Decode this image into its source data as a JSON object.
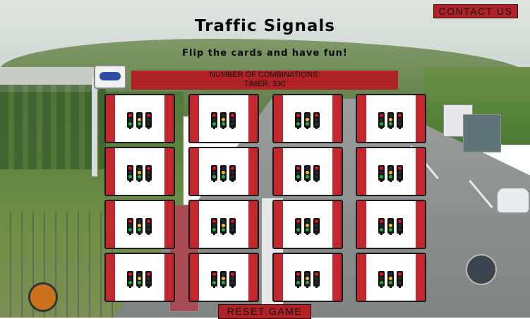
{
  "header": {
    "contact_label": "CONTACT US",
    "title": "Traffic Signals",
    "subtitle": "Flip the cards and have fun!"
  },
  "stats": {
    "combinations_label": "NUMBER OF COMBINATIONS:",
    "timer_label": "TIMER: 330"
  },
  "board": {
    "rows": 4,
    "columns": 4,
    "card_face": "traffic-lights-icon",
    "cards": 16
  },
  "colors": {
    "accent": "#b12226",
    "card_band": "#c1272d",
    "lamp_red": "#e0141b",
    "lamp_yellow": "#f2c21b",
    "lamp_green": "#1fb23a"
  },
  "footer": {
    "reset_label": "RESET GAME"
  }
}
